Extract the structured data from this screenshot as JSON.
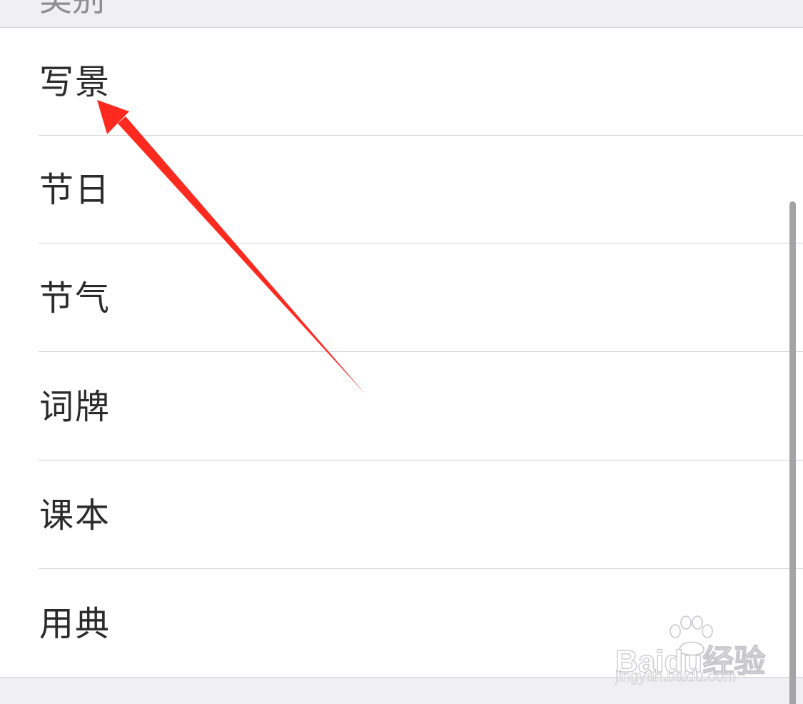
{
  "section_header": {
    "label": "类别"
  },
  "categories": [
    {
      "label": "写景"
    },
    {
      "label": "节日"
    },
    {
      "label": "节气"
    },
    {
      "label": "词牌"
    },
    {
      "label": "课本"
    },
    {
      "label": "用典"
    }
  ],
  "annotation": {
    "arrow_color": "#ff2a1f",
    "arrow_icon": "red-arrow-icon"
  },
  "watermark": {
    "brand": "Baidu经验",
    "url": "jingyan.baidu.com",
    "icon": "paw-icon"
  },
  "colors": {
    "background": "#ffffff",
    "grouped_background": "#efeff4",
    "separator": "#d3d3d6",
    "text": "#2b2b2b",
    "header_text": "#8e8e93",
    "scrollbar": "#a4a4a6"
  }
}
